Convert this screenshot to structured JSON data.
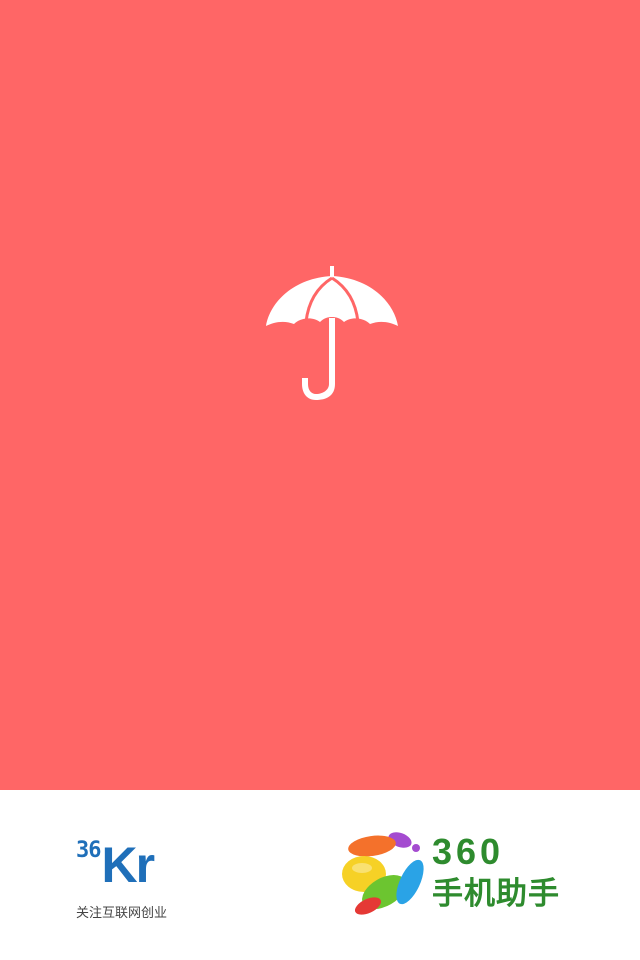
{
  "splash": {
    "background_color": "#ff6666",
    "icon": "umbrella-icon"
  },
  "footer": {
    "kr36": {
      "number": "36",
      "letters": "Kr",
      "tagline": "关注互联网创业",
      "color": "#1f6fb9"
    },
    "assistant360": {
      "number": "360",
      "name": "手机助手",
      "icon": "360-colorful-ball-icon",
      "color": "#2e8b2e"
    }
  }
}
